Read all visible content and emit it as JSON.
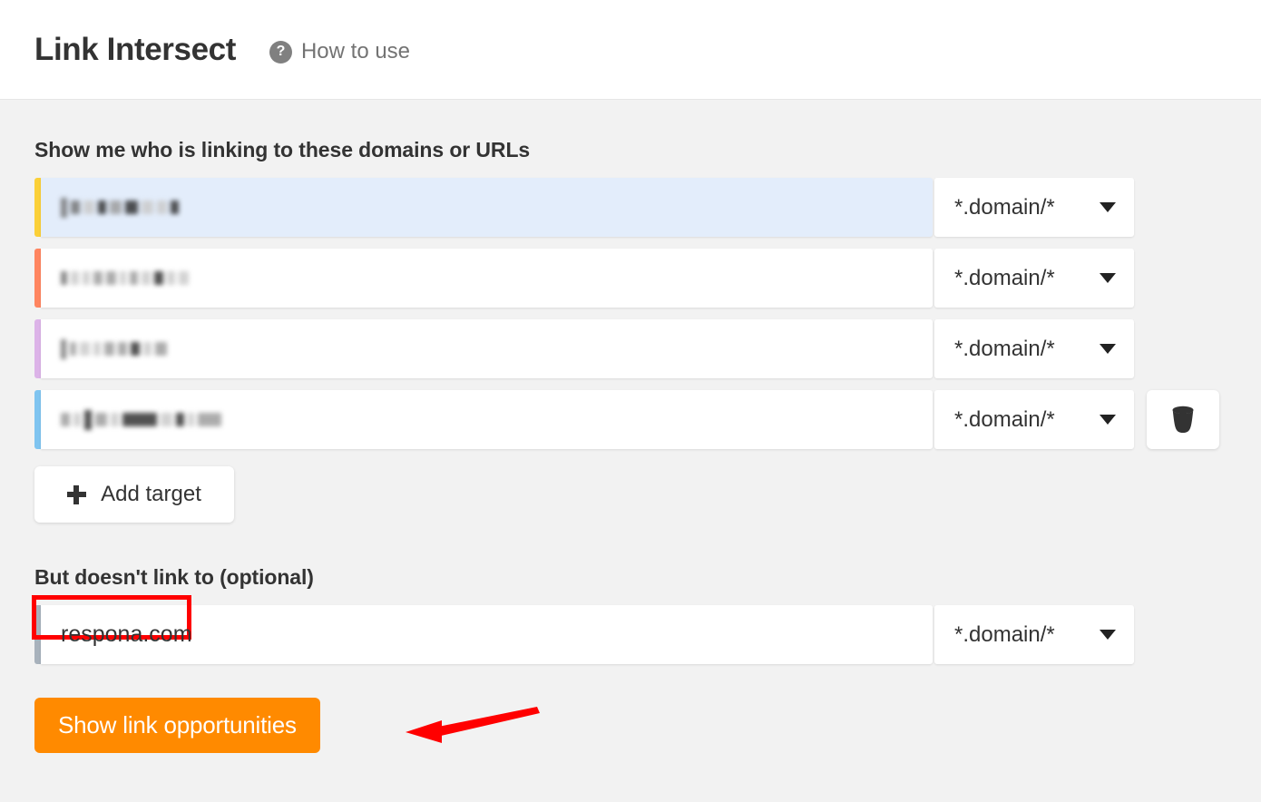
{
  "header": {
    "title": "Link Intersect",
    "help_icon": "question-mark-circle-icon",
    "howto_label": "How to use"
  },
  "targets_section": {
    "title": "Show me who is linking to these domains or URLs",
    "rows": [
      {
        "accent_color": "#fbd038",
        "value": "",
        "redacted": true,
        "selected": true,
        "mode": "*.domain/*",
        "caret_icon": "chevron-down-icon",
        "has_delete": false
      },
      {
        "accent_color": "#ff8560",
        "value": "",
        "redacted": true,
        "selected": false,
        "mode": "*.domain/*",
        "caret_icon": "chevron-down-icon",
        "has_delete": false
      },
      {
        "accent_color": "#dcb3e8",
        "value": "",
        "redacted": true,
        "selected": false,
        "mode": "*.domain/*",
        "caret_icon": "chevron-down-icon",
        "has_delete": false
      },
      {
        "accent_color": "#7fc4f0",
        "value": "",
        "redacted": true,
        "selected": false,
        "mode": "*.domain/*",
        "caret_icon": "chevron-down-icon",
        "has_delete": true,
        "delete_icon": "trash-icon"
      }
    ],
    "add_target": {
      "label": "Add target",
      "icon": "plus-icon"
    }
  },
  "exclusion_section": {
    "title": "But doesn't link to (optional)",
    "row": {
      "accent_color": "#a8b2bc",
      "value": "respona.com",
      "mode": "*.domain/*",
      "caret_icon": "chevron-down-icon",
      "highlight_color": "#ff0000"
    }
  },
  "cta": {
    "label": "Show link opportunities",
    "color": "#ff8a00"
  },
  "annotations": {
    "arrow_color": "#ff0000",
    "arrow_icon": "arrow-left-icon"
  }
}
